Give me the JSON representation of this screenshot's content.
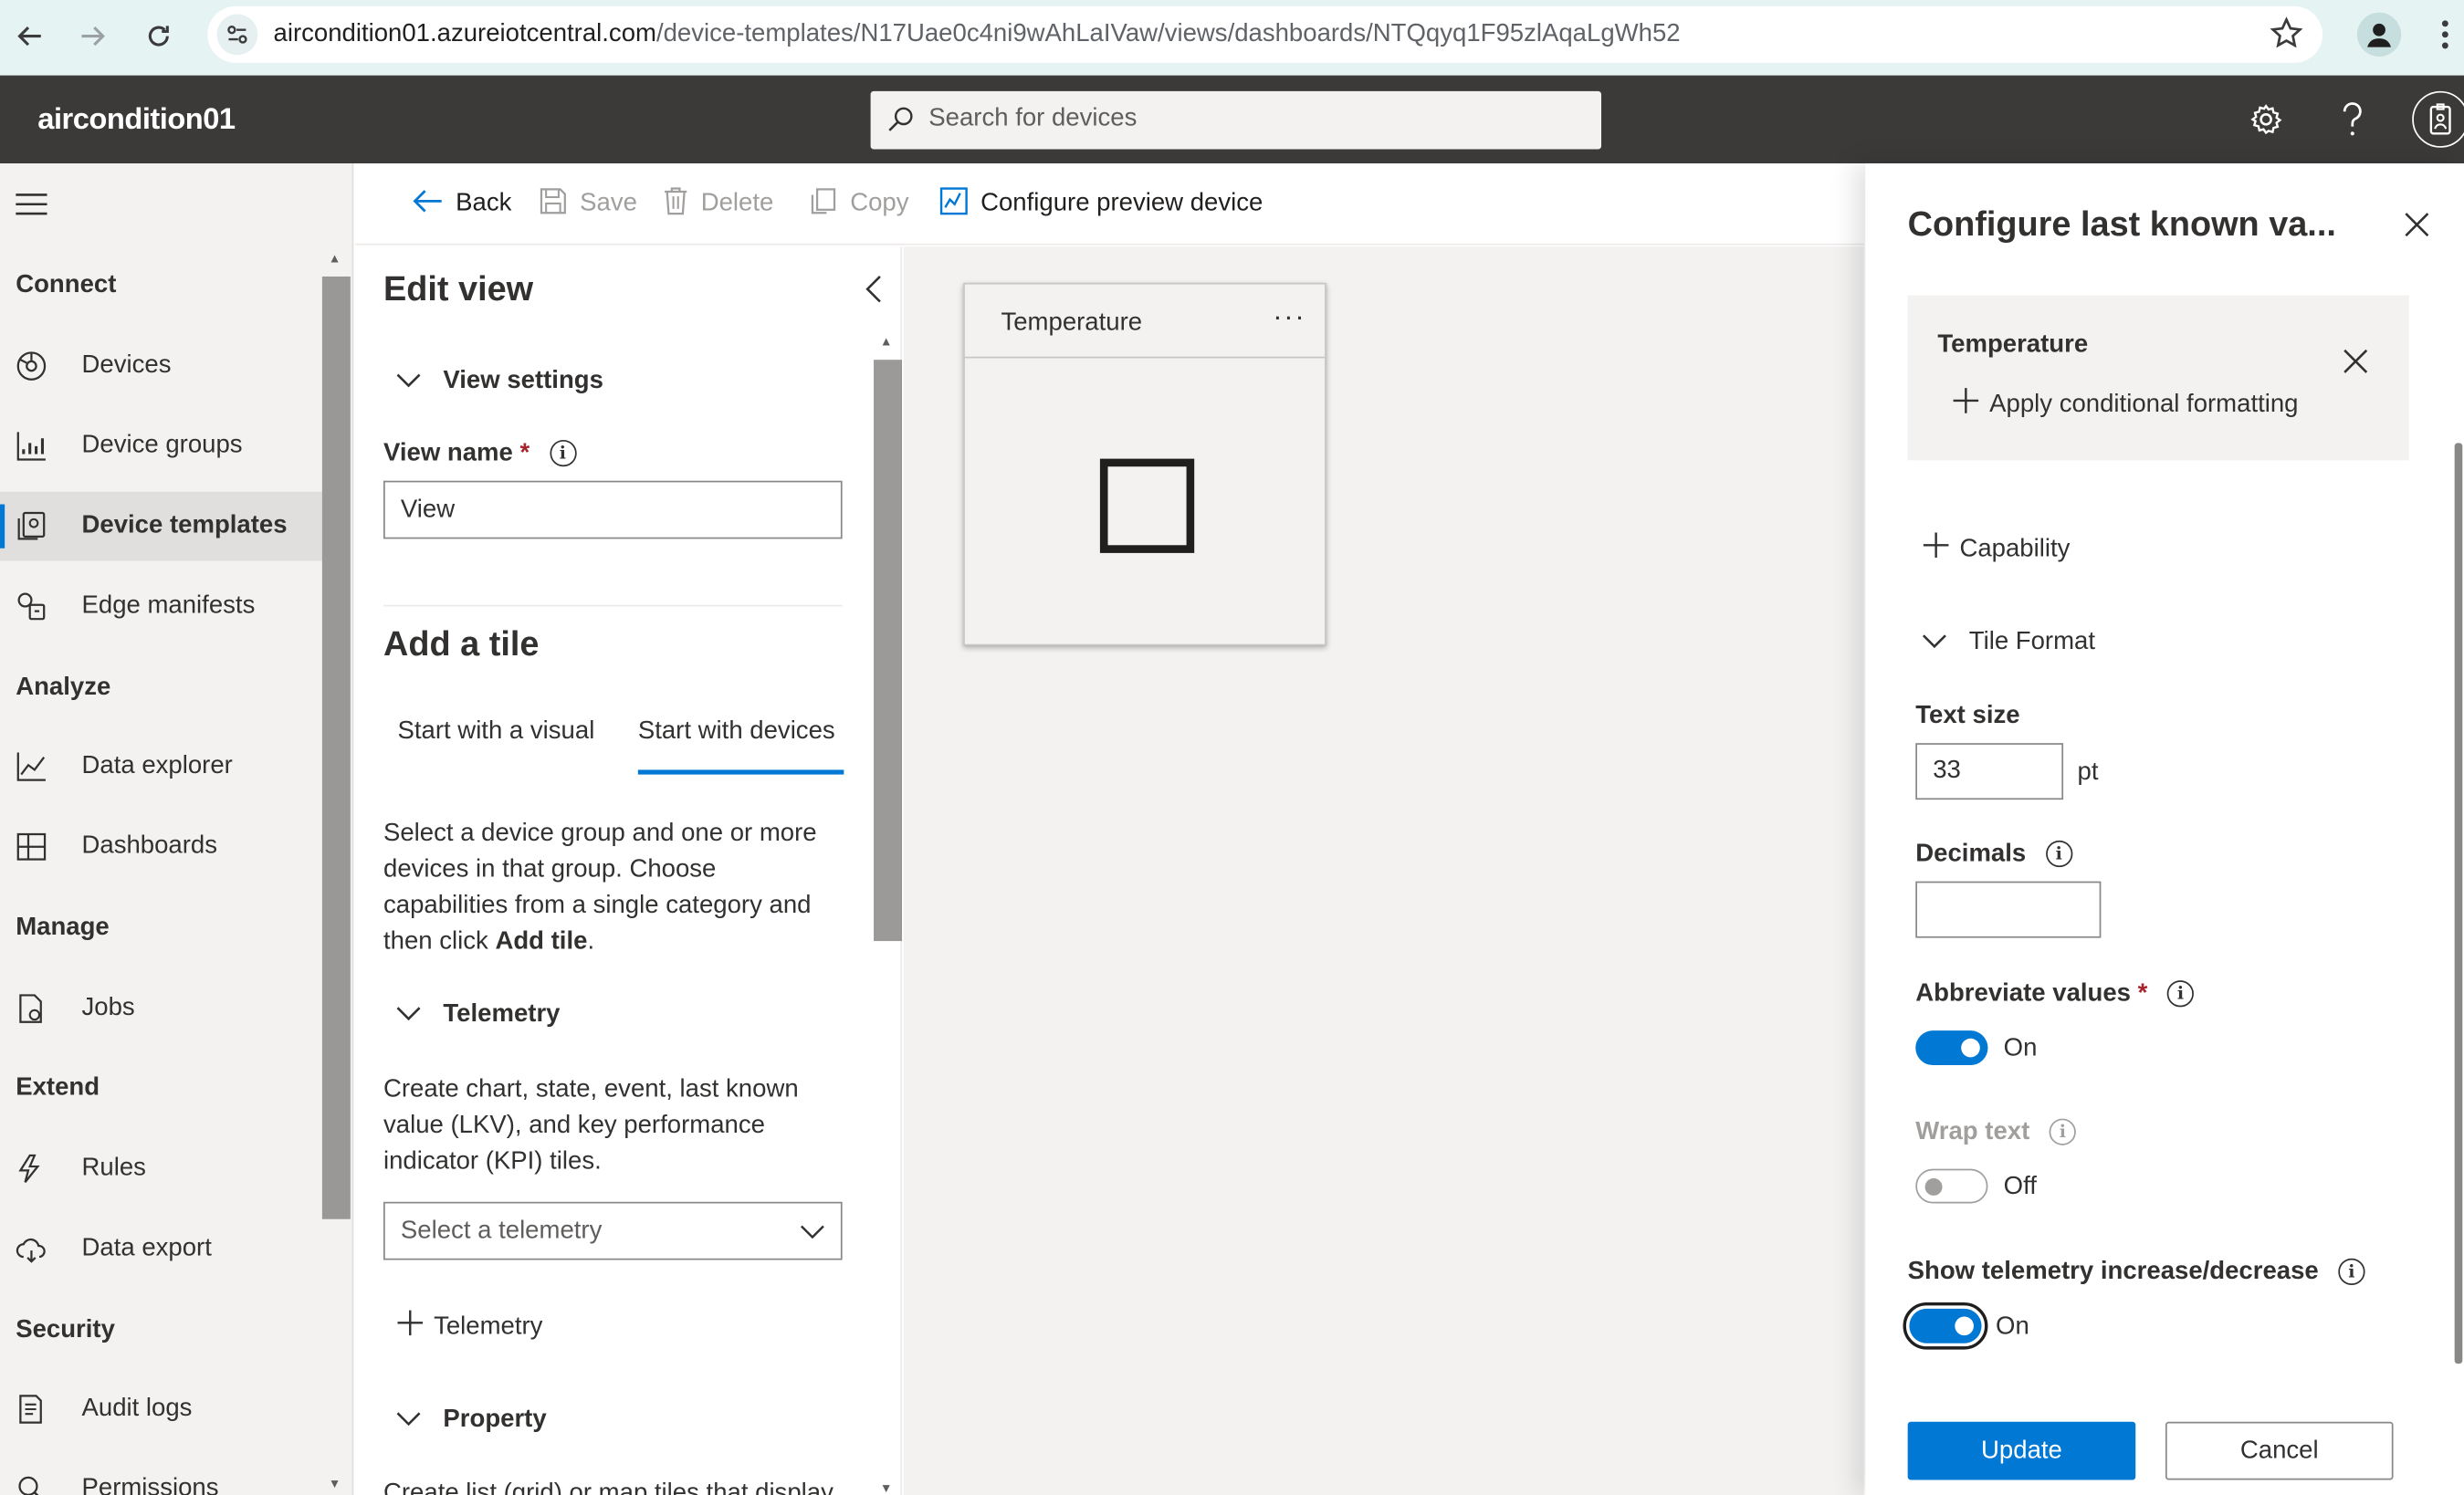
{
  "browser": {
    "url_host": "aircondition01.azureiotcentral.com",
    "url_path": "/device-templates/N17Uae0c4ni9wAhLaIVaw/views/dashboards/NTQqyq1F95zlAqaLgWh52"
  },
  "header": {
    "app_name": "aircondition01",
    "search_placeholder": "Search for devices"
  },
  "sidebar": {
    "sections": {
      "connect": "Connect",
      "analyze": "Analyze",
      "manage": "Manage",
      "extend": "Extend",
      "security": "Security"
    },
    "items": {
      "devices": "Devices",
      "device_groups": "Device groups",
      "device_templates": "Device templates",
      "edge_manifests": "Edge manifests",
      "data_explorer": "Data explorer",
      "dashboards": "Dashboards",
      "jobs": "Jobs",
      "rules": "Rules",
      "data_export": "Data export",
      "audit_logs": "Audit logs",
      "permissions": "Permissions"
    },
    "active": "Device templates"
  },
  "toolbar": {
    "back": "Back",
    "save": "Save",
    "delete": "Delete",
    "copy": "Copy",
    "configure_preview": "Configure preview device"
  },
  "edit_view": {
    "title": "Edit view",
    "view_settings": "View settings",
    "view_name_label": "View name",
    "view_name_required": "*",
    "view_name_value": "View",
    "add_tile": "Add a tile",
    "tabs": [
      "Start with a visual",
      "Start with devices"
    ],
    "selected_tab": "Start with devices",
    "devices_desc_part1": "Select a device group and one or more devices in that group. Choose capabilities from a single category and then click ",
    "devices_desc_bold": "Add tile",
    "devices_desc_end": ".",
    "telemetry_section": "Telemetry",
    "telemetry_desc": "Create chart, state, event, last known value (LKV), and key performance indicator (KPI) tiles.",
    "telemetry_select_placeholder": "Select a telemetry",
    "add_telemetry": "Telemetry",
    "property_section": "Property",
    "property_desc": "Create list (grid) or map tiles that display"
  },
  "canvas": {
    "tile_title": "Temperature",
    "tile_more": "···"
  },
  "config_panel": {
    "title": "Configure last known va...",
    "card_title": "Temperature",
    "apply_conditional": "Apply conditional formatting",
    "add_capability": "Capability",
    "tile_format": "Tile Format",
    "text_size_label": "Text size",
    "text_size_value": "33",
    "text_size_unit": "pt",
    "decimals_label": "Decimals",
    "decimals_value": "",
    "abbreviate_label": "Abbreviate values",
    "abbreviate_required": "*",
    "abbreviate_state": "On",
    "wrap_label": "Wrap text",
    "wrap_state": "Off",
    "show_telemetry_label": "Show telemetry increase/decrease",
    "show_telemetry_state": "On",
    "update_button": "Update",
    "cancel_button": "Cancel"
  },
  "colors": {
    "accent": "#0078d4",
    "app_header": "#3b3a39",
    "browser_bar": "#e6f3f3",
    "nav_bg": "#f3f2f1"
  }
}
